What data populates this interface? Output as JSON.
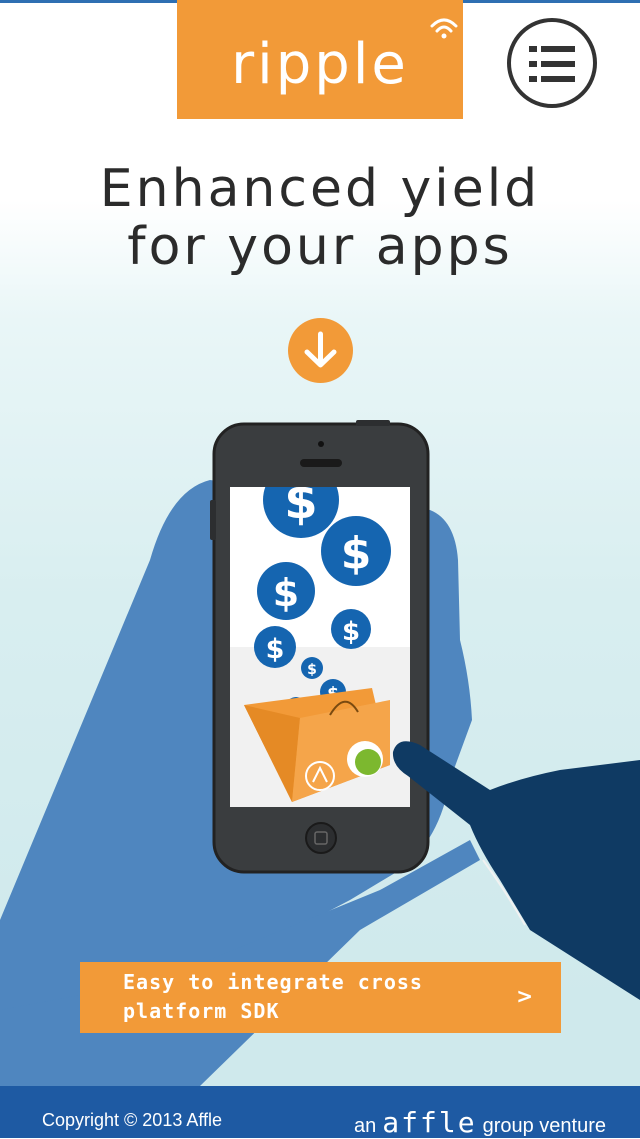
{
  "header": {
    "logo_text": "ripple",
    "menu_icon": "menu-list-icon"
  },
  "hero": {
    "headline_line1": "Enhanced yield",
    "headline_line2": "for your apps",
    "scroll_icon": "arrow-down-icon"
  },
  "cta": {
    "label": "Easy to integrate cross\nplatform SDK",
    "arrow": ">"
  },
  "footer": {
    "copyright": "Copyright © 2013 Affle",
    "venture_prefix": "an",
    "venture_brand": "affle",
    "venture_suffix": "group venture"
  },
  "colors": {
    "accent": "#f29a38",
    "footer_bg": "#1e5aa3",
    "hand_light": "#4f86bf",
    "hand_dark": "#0f3a63"
  }
}
